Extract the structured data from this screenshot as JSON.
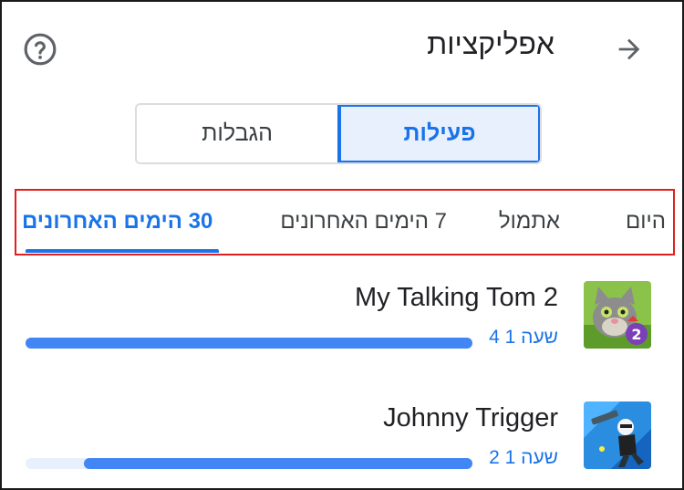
{
  "header": {
    "title": "אפליקציות",
    "back_icon": "arrow-right-icon",
    "help_icon": "help-circle-icon"
  },
  "segments": {
    "activity": "פעילות",
    "restrictions": "הגבלות",
    "selected": "activity"
  },
  "periods": {
    "today": "היום",
    "yesterday": "אתמול",
    "last7": "7 הימים האחרונים",
    "last30": "30 הימים האחרונים",
    "selected": "last30"
  },
  "apps": [
    {
      "name": "My Talking Tom 2",
      "time": "שעה 1 4",
      "usage_fraction": 1.0,
      "icon": "talking-tom-app-icon"
    },
    {
      "name": "Johnny Trigger",
      "time": "שעה 1 2",
      "usage_fraction": 0.87,
      "icon": "johnny-trigger-app-icon"
    }
  ],
  "colors": {
    "accent": "#1a73e8",
    "bar": "#4285f4",
    "highlight_box": "#e0201e"
  }
}
